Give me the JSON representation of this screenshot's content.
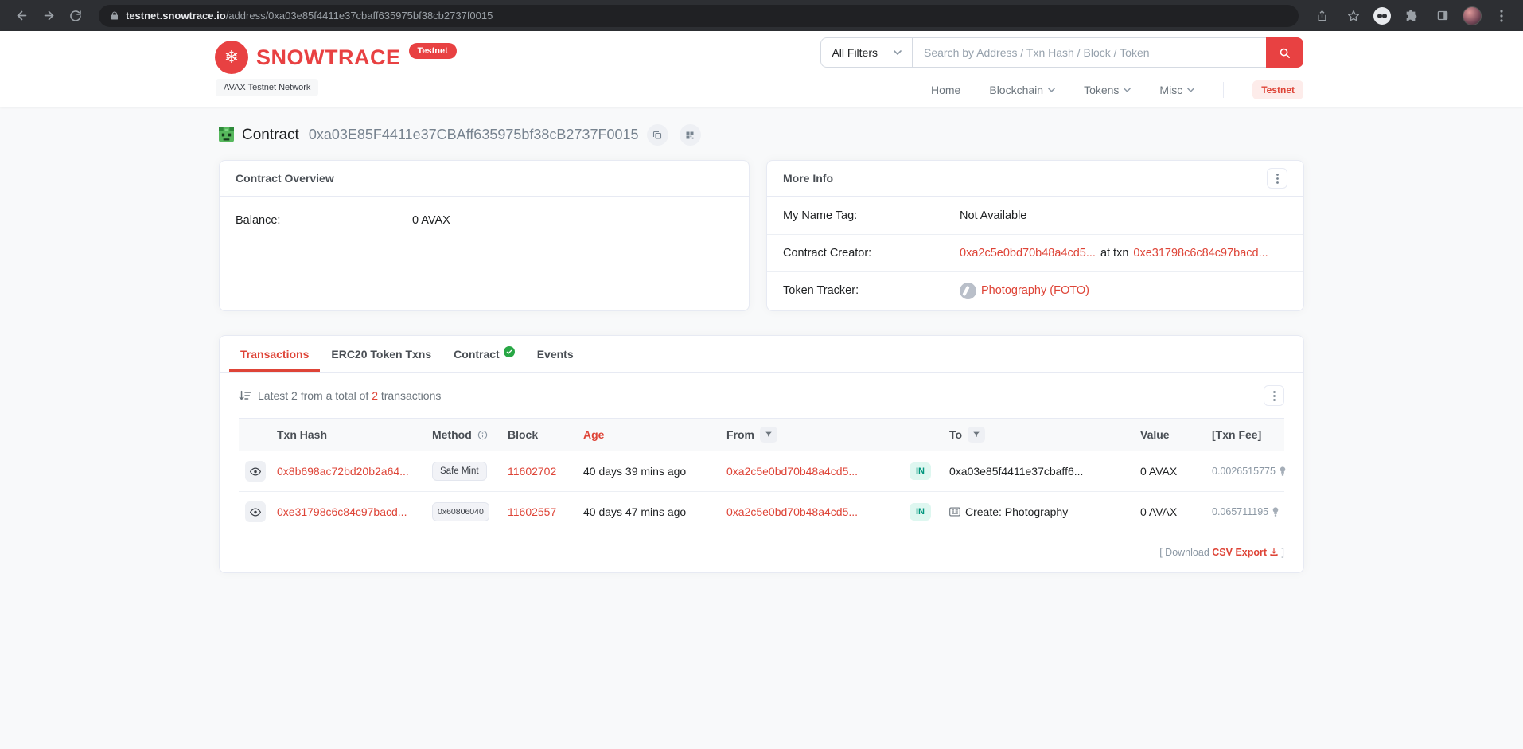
{
  "browser": {
    "url_host": "testnet.snowtrace.io",
    "url_path": "/address/0xa03e85f4411e37cbaff635975bf38cb2737f0015"
  },
  "header": {
    "brand": "SNOWTRACE",
    "brand_badge": "Testnet",
    "network_label": "AVAX Testnet Network",
    "search": {
      "filter_label": "All Filters",
      "placeholder": "Search by Address / Txn Hash / Block / Token"
    },
    "nav": {
      "home": "Home",
      "blockchain": "Blockchain",
      "tokens": "Tokens",
      "misc": "Misc",
      "testnet": "Testnet"
    }
  },
  "page": {
    "type_label": "Contract",
    "address": "0xa03E85F4411e37CBAff635975bf38cB2737F0015"
  },
  "overview": {
    "title": "Contract Overview",
    "balance_label": "Balance:",
    "balance_value": "0 AVAX"
  },
  "more_info": {
    "title": "More Info",
    "name_tag_label": "My Name Tag:",
    "name_tag_value": "Not Available",
    "creator_label": "Contract Creator:",
    "creator_address": "0xa2c5e0bd70b48a4cd5...",
    "creator_at_txn": "at txn",
    "creator_txn": "0xe31798c6c84c97bacd...",
    "token_tracker_label": "Token Tracker:",
    "token_tracker_value": "Photography (FOTO)"
  },
  "tabs": {
    "transactions": "Transactions",
    "erc20": "ERC20 Token Txns",
    "contract": "Contract",
    "events": "Events"
  },
  "transactions": {
    "summary_prefix": "Latest 2 from a total of ",
    "summary_count": "2",
    "summary_suffix": " transactions",
    "columns": {
      "hash": "Txn Hash",
      "method": "Method",
      "block": "Block",
      "age": "Age",
      "from": "From",
      "to": "To",
      "value": "Value",
      "fee": "[Txn Fee]"
    },
    "rows": [
      {
        "hash": "0x8b698ac72bd20b2a64...",
        "method": "Safe Mint",
        "block": "11602702",
        "age": "40 days 39 mins ago",
        "from": "0xa2c5e0bd70b48a4cd5...",
        "direction": "IN",
        "to": "0xa03e85f4411e37cbaff6...",
        "value": "0 AVAX",
        "fee": "0.0026515775"
      },
      {
        "hash": "0xe31798c6c84c97bacd...",
        "method": "0x60806040",
        "block": "11602557",
        "age": "40 days 47 mins ago",
        "from": "0xa2c5e0bd70b48a4cd5...",
        "direction": "IN",
        "to": "Create: Photography",
        "value": "0 AVAX",
        "fee": "0.065711195"
      }
    ],
    "download_prefix": "[ Download",
    "download_link": "CSV Export",
    "download_suffix": "]"
  },
  "colors": {
    "brand_red": "#e84142",
    "link_red": "#de4437",
    "in_badge_bg": "#def7f0",
    "in_badge_text": "#02977e",
    "border": "#e7eaf3",
    "page_bg": "#f8f9fa"
  },
  "icons": {
    "logo": "snowflake",
    "search": "magnifier",
    "sort": "sort-amount-down",
    "direction_filter": "funnel",
    "fee_hint": "gas"
  }
}
